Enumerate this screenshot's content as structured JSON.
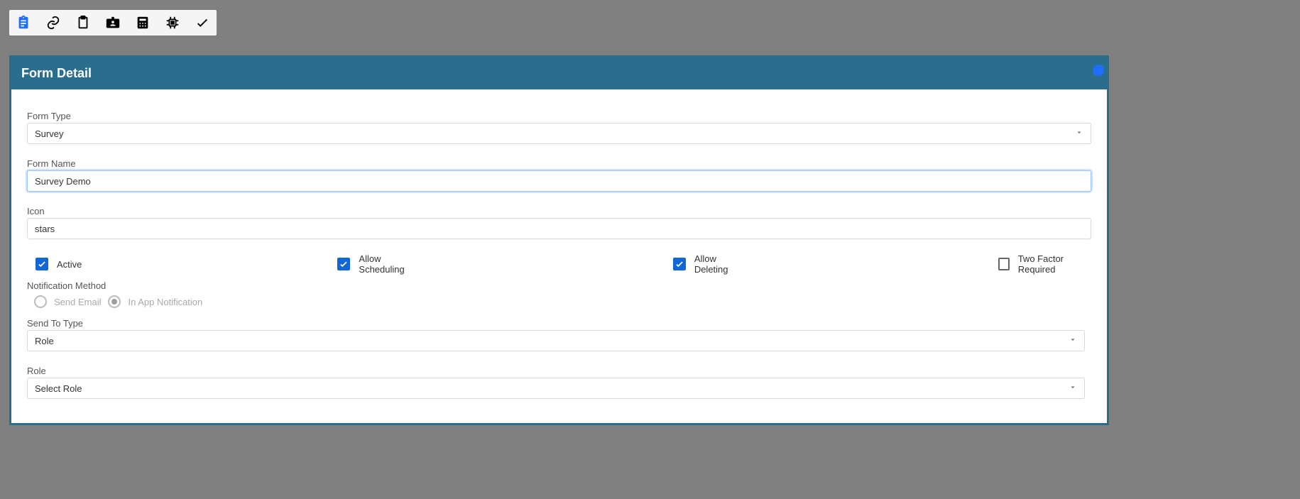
{
  "toolbar": {
    "items": [
      {
        "name": "assignment-icon",
        "active": true
      },
      {
        "name": "link-icon",
        "active": false
      },
      {
        "name": "clipboard-icon",
        "active": false
      },
      {
        "name": "id-card-icon",
        "active": false
      },
      {
        "name": "calc-icon",
        "active": false
      },
      {
        "name": "cpu-icon",
        "active": false
      },
      {
        "name": "check-icon",
        "active": false
      }
    ]
  },
  "panel": {
    "title": "Form Detail",
    "form_type": {
      "label": "Form Type",
      "value": "Survey"
    },
    "form_name": {
      "label": "Form Name",
      "value": "Survey Demo"
    },
    "icon": {
      "label": "Icon",
      "value": "stars"
    },
    "checks": {
      "active": {
        "label": "Active",
        "checked": true
      },
      "allow_scheduling": {
        "label": "Allow Scheduling",
        "checked": true
      },
      "allow_deleting": {
        "label": "Allow Deleting",
        "checked": true
      },
      "two_factor": {
        "label": "Two Factor Required",
        "checked": false
      }
    },
    "notification": {
      "label": "Notification Method",
      "options": {
        "email": {
          "label": "Send Email",
          "selected": false
        },
        "in_app": {
          "label": "In App Notification",
          "selected": true
        }
      }
    },
    "send_to": {
      "label": "Send To Type",
      "value": "Role"
    },
    "role": {
      "label": "Role",
      "value": "Select Role"
    }
  }
}
